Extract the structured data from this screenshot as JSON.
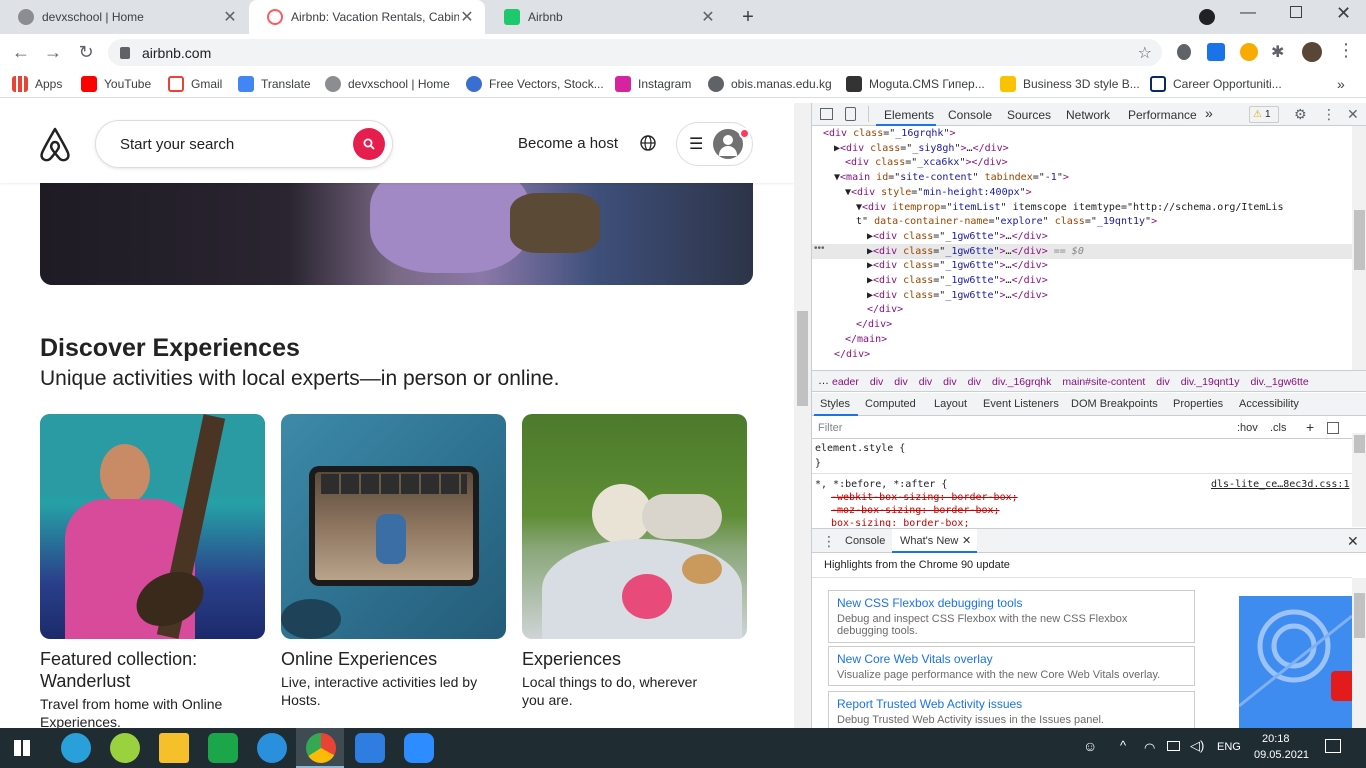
{
  "browser": {
    "tabs": [
      {
        "title": "devxschool | Home",
        "active": false
      },
      {
        "title": "Airbnb: Vacation Rentals, Cabins,",
        "active": true
      },
      {
        "title": "Airbnb",
        "active": false
      }
    ],
    "url": "airbnb.com",
    "bookmarks": [
      "Apps",
      "YouTube",
      "Gmail",
      "Translate",
      "devxschool | Home",
      "Free Vectors, Stock...",
      "Instagram",
      "obis.manas.edu.kg",
      "Moguta.CMS Гипер...",
      "Business 3D style B...",
      "Career Opportuniti..."
    ]
  },
  "airbnb": {
    "search_placeholder": "Start your search",
    "become_host": "Become a host",
    "section_title": "Discover Experiences",
    "section_subtitle": "Unique activities with local experts—in person or online.",
    "cards": [
      {
        "title": "Featured collection: Wanderlust",
        "desc": "Travel from home with Online Experiences."
      },
      {
        "title": "Online Experiences",
        "desc": "Live, interactive activities led by Hosts."
      },
      {
        "title": "Experiences",
        "desc": "Local things to do, wherever you are."
      }
    ]
  },
  "devtools": {
    "tabs": [
      "Elements",
      "Console",
      "Sources",
      "Network",
      "Performance"
    ],
    "warning_count": "1",
    "dom_lines": [
      {
        "indent": 7,
        "html": "<div class=\"_16grqhk\">"
      },
      {
        "indent": 8,
        "html": "▶<div class=\"_siy8gh\">…</div>"
      },
      {
        "indent": 9,
        "html": "<div class=\"_xca6kx\"></div>"
      },
      {
        "indent": 8,
        "html": "▼<main id=\"site-content\" tabindex=\"-1\">"
      },
      {
        "indent": 9,
        "html": "▼<div style=\"min-height:400px\">"
      },
      {
        "indent": 10,
        "html": "▼<div itemprop=\"itemList\" itemscope itemtype=\"http://schema.org/ItemLis"
      },
      {
        "indent": 10,
        "html": "t\" data-container-name=\"explore\" class=\"_19qnt1y\">"
      },
      {
        "indent": 11,
        "html": "▶<div class=\"_1gw6tte\">…</div>"
      },
      {
        "indent": 11,
        "html": "▶<div class=\"_1gw6tte\">…</div> == $0"
      },
      {
        "indent": 11,
        "html": "▶<div class=\"_1gw6tte\">…</div>"
      },
      {
        "indent": 11,
        "html": "▶<div class=\"_1gw6tte\">…</div>"
      },
      {
        "indent": 11,
        "html": "▶<div class=\"_1gw6tte\">…</div>"
      },
      {
        "indent": 11,
        "html": "</div>"
      },
      {
        "indent": 10,
        "html": "</div>"
      },
      {
        "indent": 9,
        "html": "</main>"
      },
      {
        "indent": 8,
        "html": "</div>"
      }
    ],
    "breadcrumbs": [
      "eader",
      "div",
      "div",
      "div",
      "div",
      "div",
      "div._16grqhk",
      "main#site-content",
      "div",
      "div._19qnt1y",
      "div._1gw6tte"
    ],
    "style_tabs": [
      "Styles",
      "Computed",
      "Layout",
      "Event Listeners",
      "DOM Breakpoints",
      "Properties",
      "Accessibility"
    ],
    "filter_placeholder": "Filter",
    "hov": ":hov",
    "cls": ".cls",
    "style_rules": [
      "element.style {",
      "}",
      "*, *:before, *:after {",
      "-webkit-box-sizing: border-box;",
      "-moz-box-sizing: border-box;",
      "box-sizing: border-box;"
    ],
    "stylesheet": "dls-lite_ce…8ec3d.css:1",
    "drawer_tabs": [
      "Console",
      "What's New"
    ],
    "highlights_title": "Highlights from the Chrome 90 update",
    "whats_new": [
      {
        "title": "New CSS Flexbox debugging tools",
        "desc": "Debug and inspect CSS Flexbox with the new CSS Flexbox debugging tools."
      },
      {
        "title": "New Core Web Vitals overlay",
        "desc": "Visualize page performance with the new Core Web Vitals overlay."
      },
      {
        "title": "Report Trusted Web Activity issues",
        "desc": "Debug Trusted Web Activity issues in the Issues panel."
      }
    ]
  },
  "taskbar": {
    "language": "ENG",
    "time": "20:18",
    "date": "09.05.2021"
  }
}
